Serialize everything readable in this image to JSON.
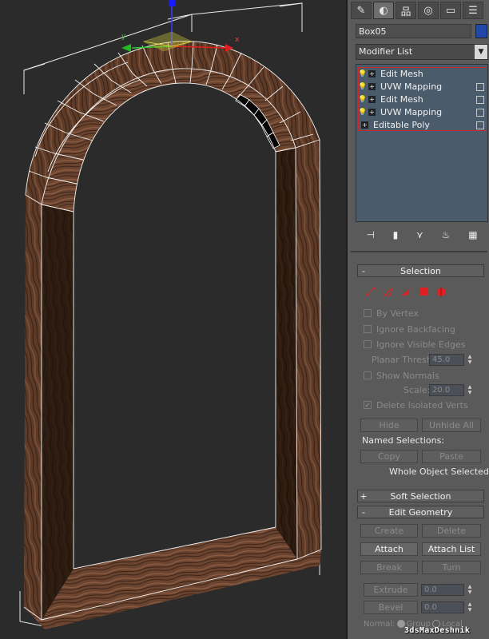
{
  "viewport": {
    "axis_labels": {
      "x": "x",
      "y": "y"
    },
    "wood_color_dark": "#3c2416",
    "wood_color_mid": "#6b4430",
    "wood_color_light": "#8a5c42",
    "wire_color": "#ffffff"
  },
  "panel": {
    "tabs": [
      {
        "icon": "create-icon",
        "glyph": "✎"
      },
      {
        "icon": "modify-icon",
        "glyph": "◐"
      },
      {
        "icon": "hierarchy-icon",
        "glyph": "品"
      },
      {
        "icon": "motion-icon",
        "glyph": "◎"
      },
      {
        "icon": "display-icon",
        "glyph": "▭"
      },
      {
        "icon": "utilities-icon",
        "glyph": "☰"
      }
    ],
    "object_name": "Box05",
    "object_color": "#1f48a8",
    "modifier_list": "Modifier List",
    "stack": [
      {
        "label": "Edit Mesh",
        "has_checkbox": false
      },
      {
        "label": "UVW Mapping",
        "has_checkbox": true
      },
      {
        "label": "Edit Mesh",
        "has_checkbox": true
      },
      {
        "label": "UVW Mapping",
        "has_checkbox": true
      },
      {
        "label": "Editable Poly",
        "has_checkbox": true
      }
    ],
    "toolbar": [
      {
        "icon": "pin-stack-icon",
        "glyph": "⊣"
      },
      {
        "icon": "show-end-result-icon",
        "glyph": "▮"
      },
      {
        "icon": "make-unique-icon",
        "glyph": "⋎"
      },
      {
        "icon": "remove-modifier-icon",
        "glyph": "♨"
      },
      {
        "icon": "configure-sets-icon",
        "glyph": "▦"
      }
    ],
    "selection": {
      "title": "Selection",
      "sign": "-",
      "by_vertex": "By Vertex",
      "ignore_backfacing": "Ignore Backfacing",
      "ignore_visible_edges": "Ignore Visible Edges",
      "planar_thresh_label": "Planar Thresh:",
      "planar_thresh_value": "45.0",
      "show_normals": "Show Normals",
      "scale_label": "Scale:",
      "scale_value": "20.0",
      "delete_isolated": "Delete Isolated Verts",
      "hide": "Hide",
      "unhide_all": "Unhide All",
      "named_selections": "Named Selections:",
      "copy": "Copy",
      "paste": "Paste",
      "status": "Whole Object Selected"
    },
    "soft_selection": {
      "title": "Soft Selection",
      "sign": "+"
    },
    "edit_geometry": {
      "title": "Edit Geometry",
      "sign": "-",
      "create": "Create",
      "delete": "Delete",
      "attach": "Attach",
      "attach_list": "Attach List",
      "break": "Break",
      "turn": "Turn",
      "extrude": "Extrude",
      "extrude_value": "0.0",
      "bevel": "Bevel",
      "bevel_value": "0.0",
      "normal_label": "Normal:",
      "group": "Group",
      "local": "Local"
    }
  },
  "watermark": "3dsMaxDeshnik"
}
